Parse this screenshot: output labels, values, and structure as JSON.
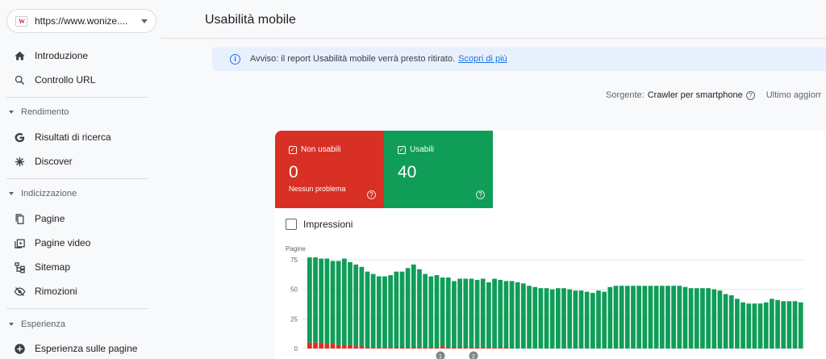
{
  "property": {
    "logo": "W",
    "url": "https://www.wonize...."
  },
  "nav": {
    "intro": "Introduzione",
    "url_inspect": "Controllo URL",
    "sec_performance": "Rendimento",
    "search_results": "Risultati di ricerca",
    "discover": "Discover",
    "sec_index": "Indicizzazione",
    "pages": "Pagine",
    "video_pages": "Pagine video",
    "sitemap": "Sitemap",
    "removals": "Rimozioni",
    "sec_experience": "Esperienza",
    "page_experience": "Esperienza sulle pagine"
  },
  "header": {
    "title": "Usabilità mobile"
  },
  "banner": {
    "text": "Avviso: il report Usabilità mobile verrà presto ritirato.",
    "link": "Scopri di più"
  },
  "source": {
    "label": "Sorgente:",
    "value": "Crawler per smartphone",
    "last_updated": "Ultimo aggiorr"
  },
  "cards": {
    "not_usable": {
      "label": "Non usabili",
      "value": "0",
      "sub": "Nessun problema"
    },
    "usable": {
      "label": "Usabili",
      "value": "40"
    }
  },
  "impressions": {
    "label": "Impressioni"
  },
  "colors": {
    "red": "#d93025",
    "green": "#0f9d58",
    "accent": "#1a73e8"
  },
  "chart_data": {
    "type": "bar",
    "ylabel": "Pagine",
    "ylim": [
      0,
      75
    ],
    "yticks": [
      "0",
      "25",
      "50",
      "75"
    ],
    "annotations": [
      "1",
      "2"
    ],
    "series": [
      {
        "name": "Usabili",
        "values": [
          72,
          72,
          71,
          72,
          70,
          71,
          73,
          70,
          69,
          67,
          64,
          62,
          60,
          60,
          61,
          64,
          64,
          67,
          70,
          66,
          62,
          60,
          61,
          58,
          59,
          56,
          58,
          58,
          58,
          57,
          58,
          56,
          59,
          58,
          57,
          57,
          56,
          55,
          53,
          52,
          51,
          51,
          50,
          51,
          51,
          50,
          49,
          49,
          48,
          47,
          49,
          48,
          52,
          53,
          53,
          53,
          53,
          53,
          53,
          53,
          53,
          53,
          53,
          53,
          53,
          52,
          51,
          51,
          51,
          51,
          50,
          49,
          46,
          45,
          42,
          39,
          38,
          38,
          38,
          39,
          42,
          41,
          40,
          40,
          40,
          39
        ]
      },
      {
        "name": "Non usabili",
        "values": [
          5,
          5,
          5,
          4,
          4,
          3,
          3,
          3,
          2,
          2,
          1,
          1,
          1,
          1,
          1,
          1,
          1,
          1,
          1,
          1,
          1,
          1,
          1,
          2,
          1,
          1,
          1,
          1,
          1,
          1,
          1,
          0,
          0,
          0,
          0,
          0,
          0,
          0,
          0,
          0,
          0,
          0,
          0,
          0,
          0,
          0,
          0,
          0,
          0,
          0,
          0,
          0,
          0,
          0,
          0,
          0,
          0,
          0,
          0,
          0,
          0,
          0,
          0,
          0,
          0,
          0,
          0,
          0,
          0,
          0,
          0,
          0,
          0,
          0,
          0,
          0,
          0,
          0,
          0,
          0,
          0,
          0,
          0,
          0,
          0,
          0
        ]
      }
    ]
  }
}
